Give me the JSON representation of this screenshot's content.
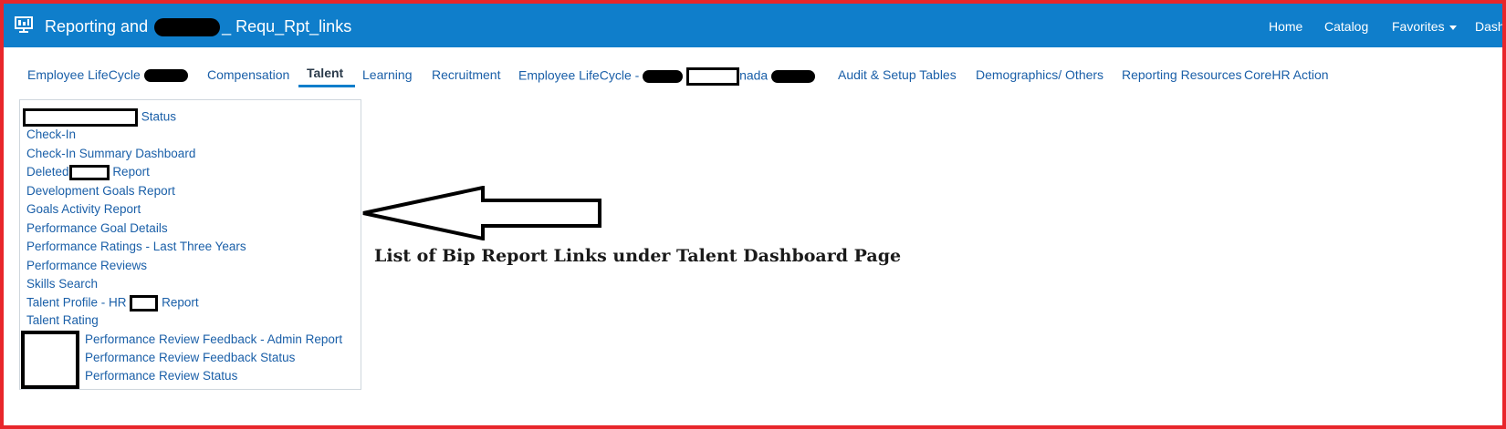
{
  "header": {
    "title_prefix": "Reporting and",
    "title_suffix": "_ Requ_Rpt_links",
    "nav": {
      "home": "Home",
      "catalog": "Catalog",
      "favorites": "Favorites",
      "dashboards": "Dash"
    }
  },
  "tabs": {
    "t1": "Employee LifeCycle",
    "t2": "Compensation",
    "t3": "Talent",
    "t4": "Learning",
    "t5": "Recruitment",
    "t6_prefix": "Employee LifeCycle -",
    "t6_mid": "nada",
    "t7": "Audit & Setup Tables",
    "t8": "Demographics/ Others",
    "t9": "Reporting Resources",
    "t10": "CoreHR Action"
  },
  "links": {
    "l1": "Status",
    "l2": "Check-In",
    "l3": "Check-In Summary Dashboard",
    "l4a": "Deleted",
    "l4b": "Report",
    "l5": "Development Goals Report",
    "l6": "Goals Activity Report",
    "l7": "Performance Goal Details",
    "l8": "Performance Ratings - Last Three Years",
    "l9": "Performance Reviews",
    "l10": "Skills Search",
    "l11a": "Talent Profile - HR",
    "l11b": "Report",
    "l12": "Talent Rating",
    "l13": "Performance Review Feedback - Admin Report",
    "l14": "Performance Review Feedback Status",
    "l15": "Performance Review Status"
  },
  "annotation": {
    "caption": "List of Bip Report Links under Talent Dashboard Page"
  },
  "colors": {
    "header_bg": "#0f7ecb",
    "link": "#1a5fa8",
    "frame": "#e8262b"
  },
  "icons": {
    "app": "dashboard-monitor-icon",
    "favorites_caret": "caret-down-icon"
  }
}
